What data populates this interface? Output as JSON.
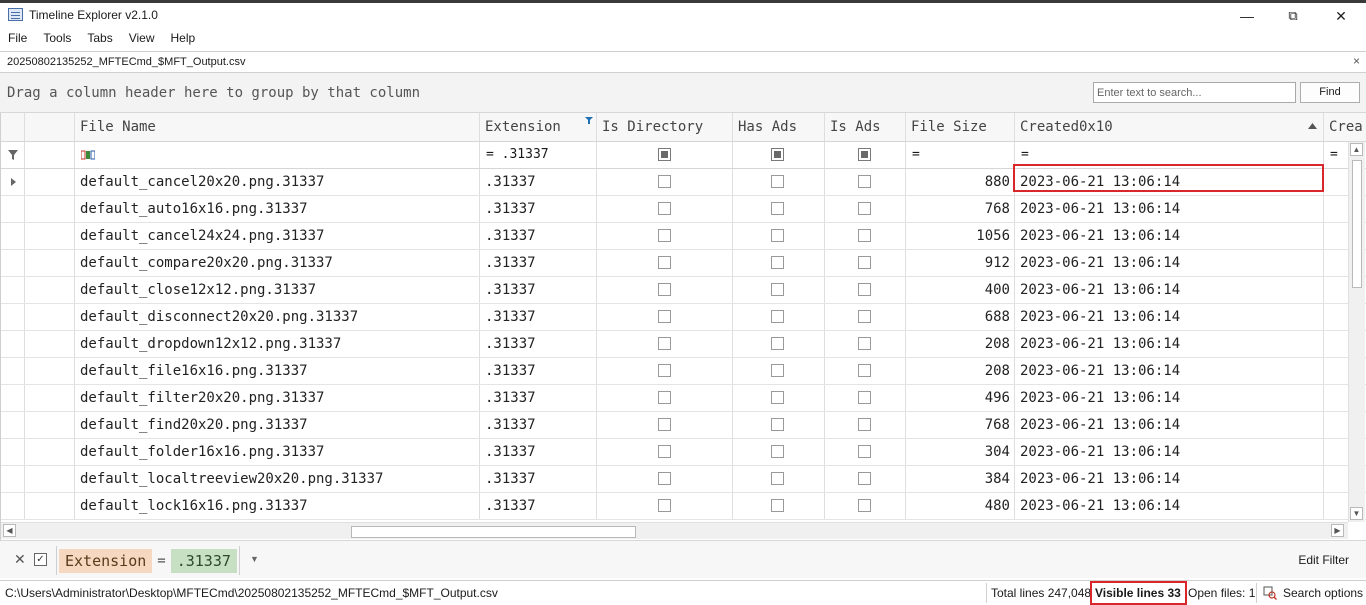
{
  "window": {
    "title": "Timeline Explorer v2.1.0",
    "minimize": "—",
    "restore": "⧉",
    "close": "✕"
  },
  "menu": [
    "File",
    "Tools",
    "Tabs",
    "View",
    "Help"
  ],
  "doc_tab": {
    "label": "20250802135252_MFTECmd_$MFT_Output.csv",
    "close": "×"
  },
  "group_panel": {
    "hint": "Drag a column header here to group by that column",
    "search_placeholder": "Enter text to search...",
    "find_label": "Find"
  },
  "columns": {
    "file_name": "File Name",
    "extension": "Extension",
    "is_directory": "Is Directory",
    "has_ads": "Has Ads",
    "is_ads": "Is Ads",
    "file_size": "File Size",
    "created": "Created0x10",
    "next": "Crea"
  },
  "filter_row": {
    "extension": "= .31337",
    "file_size": "=",
    "created": "=",
    "next": "="
  },
  "rows": [
    {
      "file_name": "default_cancel20x20.png.31337",
      "extension": ".31337",
      "file_size": "880",
      "created": "2023-06-21 13:06:14"
    },
    {
      "file_name": "default_auto16x16.png.31337",
      "extension": ".31337",
      "file_size": "768",
      "created": "2023-06-21 13:06:14"
    },
    {
      "file_name": "default_cancel24x24.png.31337",
      "extension": ".31337",
      "file_size": "1056",
      "created": "2023-06-21 13:06:14"
    },
    {
      "file_name": "default_compare20x20.png.31337",
      "extension": ".31337",
      "file_size": "912",
      "created": "2023-06-21 13:06:14"
    },
    {
      "file_name": "default_close12x12.png.31337",
      "extension": ".31337",
      "file_size": "400",
      "created": "2023-06-21 13:06:14"
    },
    {
      "file_name": "default_disconnect20x20.png.31337",
      "extension": ".31337",
      "file_size": "688",
      "created": "2023-06-21 13:06:14"
    },
    {
      "file_name": "default_dropdown12x12.png.31337",
      "extension": ".31337",
      "file_size": "208",
      "created": "2023-06-21 13:06:14"
    },
    {
      "file_name": "default_file16x16.png.31337",
      "extension": ".31337",
      "file_size": "208",
      "created": "2023-06-21 13:06:14"
    },
    {
      "file_name": "default_filter20x20.png.31337",
      "extension": ".31337",
      "file_size": "496",
      "created": "2023-06-21 13:06:14"
    },
    {
      "file_name": "default_find20x20.png.31337",
      "extension": ".31337",
      "file_size": "768",
      "created": "2023-06-21 13:06:14"
    },
    {
      "file_name": "default_folder16x16.png.31337",
      "extension": ".31337",
      "file_size": "304",
      "created": "2023-06-21 13:06:14"
    },
    {
      "file_name": "default_localtreeview20x20.png.31337",
      "extension": ".31337",
      "file_size": "384",
      "created": "2023-06-21 13:06:14"
    },
    {
      "file_name": "default_lock16x16.png.31337",
      "extension": ".31337",
      "file_size": "480",
      "created": "2023-06-21 13:06:14"
    }
  ],
  "filter_panel": {
    "field": "Extension",
    "operator": "=",
    "value": ".31337",
    "edit_label": "Edit Filter"
  },
  "status": {
    "path": "C:\\Users\\Administrator\\Desktop\\MFTECmd\\20250802135252_MFTECmd_$MFT_Output.csv",
    "total_lines": "Total lines 247,048",
    "visible_lines": "Visible lines 33",
    "open_files": "Open files: 1",
    "search_options": "Search options"
  },
  "colors": {
    "highlight": "#d9262b",
    "filter_field_bg": "#f6d8c0",
    "filter_value_bg": "#c7e0c4"
  }
}
